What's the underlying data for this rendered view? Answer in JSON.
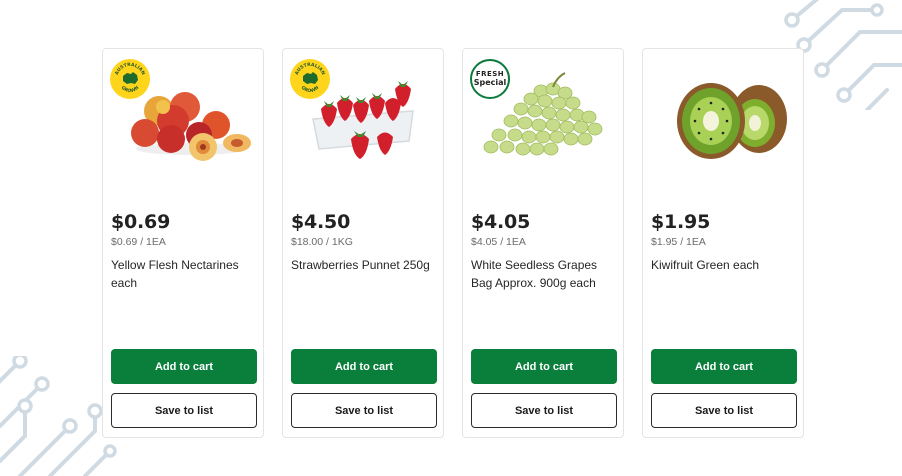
{
  "products": [
    {
      "badge": {
        "type": "australian-grown",
        "top": "AUSTRALIAN",
        "bottom": "GROWN"
      },
      "image_icon": "nectarines-image",
      "price": "$0.69",
      "unit_price": "$0.69 / 1EA",
      "name": "Yellow Flesh Nectarines each",
      "add_label": "Add to cart",
      "save_label": "Save to list"
    },
    {
      "badge": {
        "type": "australian-grown",
        "top": "AUSTRALIAN",
        "bottom": "GROWN"
      },
      "image_icon": "strawberries-image",
      "price": "$4.50",
      "unit_price": "$18.00 / 1KG",
      "name": "Strawberries Punnet 250g",
      "add_label": "Add to cart",
      "save_label": "Save to list"
    },
    {
      "badge": {
        "type": "fresh-special",
        "line1": "FRESH",
        "line2": "Special"
      },
      "image_icon": "grapes-image",
      "price": "$4.05",
      "unit_price": "$4.05 / 1EA",
      "name": "White Seedless Grapes Bag Approx. 900g each",
      "add_label": "Add to cart",
      "save_label": "Save to list"
    },
    {
      "badge": null,
      "image_icon": "kiwifruit-image",
      "price": "$1.95",
      "unit_price": "$1.95 / 1EA",
      "name": "Kiwifruit Green each",
      "add_label": "Add to cart",
      "save_label": "Save to list"
    }
  ],
  "colors": {
    "brand_green": "#0a7f3c",
    "badge_yellow": "#ffd51c",
    "decoration": "#c9d6e0"
  }
}
